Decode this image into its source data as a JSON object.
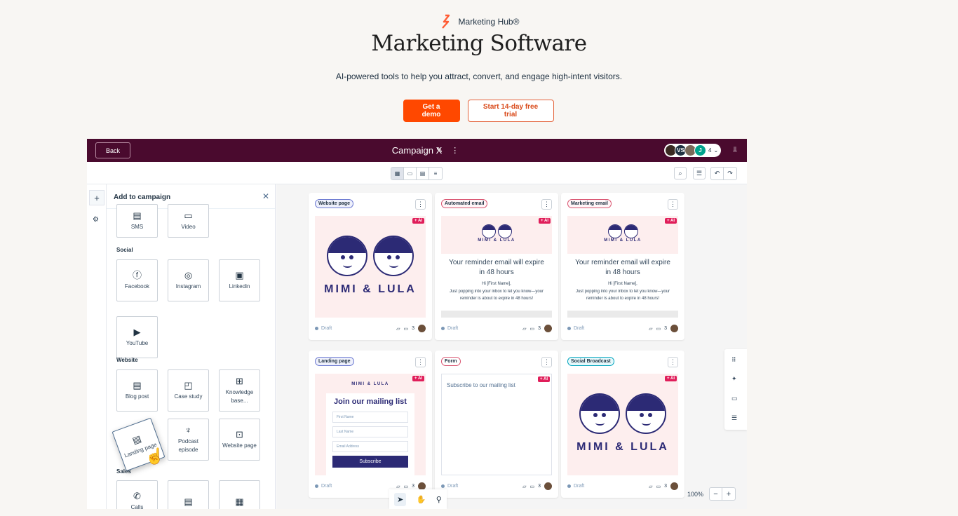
{
  "hero": {
    "brand": "Marketing Hub®",
    "title": "Marketing Software",
    "subtitle": "AI-powered tools to help you attract, convert, and engage high-intent visitors.",
    "primary_cta": "Get a demo",
    "secondary_cta": "Start 14-day free trial",
    "brand_color": "#ff4800"
  },
  "app": {
    "back_label": "Back",
    "campaign_title": "Campaign X",
    "collaborators": [
      "",
      "VS",
      "",
      "J"
    ],
    "collaborator_count": "4",
    "undo_label": "↶",
    "redo_label": "↷",
    "panel": {
      "title": "Add to campaign",
      "top_items": [
        "SMS",
        "Video"
      ],
      "sections": [
        {
          "label": "Social",
          "items": [
            "Facebook",
            "Instagram",
            "Linkedin",
            "YouTube"
          ]
        },
        {
          "label": "Website",
          "items": [
            "Blog post",
            "Case study",
            "Knowledge base...",
            "Landing page",
            "Podcast episode",
            "Website page"
          ]
        },
        {
          "label": "Sales",
          "items": [
            "Calls"
          ]
        }
      ]
    },
    "cards": [
      {
        "tag": "Website page",
        "status": "Draft",
        "comments": "3",
        "ai": "+ AI",
        "brand": "MIMI & LULA"
      },
      {
        "tag": "Automated email",
        "status": "Draft",
        "comments": "3",
        "ai": "+ AI",
        "brand": "MIMI & LULA",
        "headline": "Your reminder email will expire in 48 hours",
        "greeting": "Hi [First Name],",
        "body": "Just popping into your inbox to let you know—your reminder is about to expire in 48 hours!"
      },
      {
        "tag": "Marketing email",
        "status": "Draft",
        "comments": "3",
        "ai": "+ AI",
        "brand": "MIMI & LULA",
        "headline": "Your reminder email will expire in 48 hours",
        "greeting": "Hi [First Name],",
        "body": "Just popping into your inbox to let you know—your reminder is about to expire in 48 hours!"
      },
      {
        "tag": "Landing page",
        "status": "Draft",
        "comments": "3",
        "ai": "+ AI",
        "brand": "MIMI & LULA",
        "form_title": "Join our mailing list",
        "fields": [
          "First Name",
          "Last Name",
          "Email Address"
        ],
        "button": "Subscribe"
      },
      {
        "tag": "Form",
        "status": "Draft",
        "comments": "3",
        "ai": "+ AI",
        "text": "Subscribe to our mailing list"
      },
      {
        "tag": "Social Broadcast",
        "status": "Draft",
        "comments": "3",
        "ai": "+ AI",
        "brand": "MIMI & LULA"
      }
    ],
    "zoom": "100%"
  }
}
